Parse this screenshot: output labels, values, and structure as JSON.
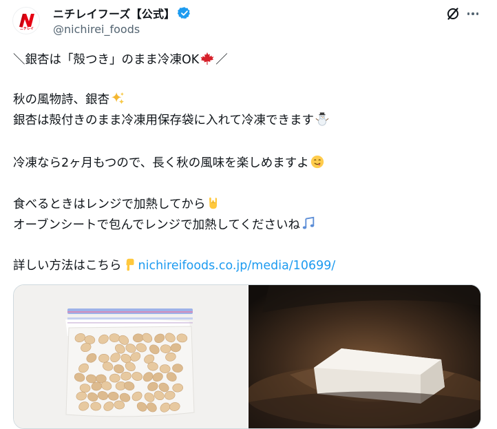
{
  "account": {
    "display_name": "ニチレイフーズ【公式】",
    "handle": "@nichirei_foods",
    "logo_text": "ニチレイ",
    "verified": true,
    "brand_color": "#e60012"
  },
  "post": {
    "lines": [
      {
        "parts": [
          {
            "text": "＼銀杏は「殻つき」のまま冷凍OK"
          },
          {
            "emoji": "maple-leaf"
          },
          {
            "text": "／"
          }
        ]
      },
      {
        "parts": [
          {
            "text": "秋の風物詩、銀杏"
          },
          {
            "emoji": "sparkles"
          }
        ]
      },
      {
        "parts": [
          {
            "text": "銀杏は殻付きのまま冷凍用保存袋に入れて冷凍できます"
          },
          {
            "emoji": "snowman"
          }
        ]
      },
      {
        "parts": [
          {
            "text": "冷凍なら2ヶ月もつので、長く秋の風味を楽しめますよ"
          },
          {
            "emoji": "yum-face"
          }
        ]
      },
      {
        "parts": [
          {
            "text": "食べるときはレンジで加熱してから"
          },
          {
            "emoji": "rock-on-hand"
          }
        ]
      },
      {
        "parts": [
          {
            "text": "オーブンシートで包んでレンジで加熱してくださいね"
          },
          {
            "emoji": "musical-notes"
          }
        ]
      },
      {
        "parts": [
          {
            "text": "詳しい方法はこちら"
          },
          {
            "emoji": "pointing-down"
          },
          {
            "link": "nichireifoods.co.jp/media/10699/"
          }
        ]
      }
    ],
    "link_color": "#1d9bf0"
  },
  "media": {
    "images": [
      {
        "name": "ginkgo-nuts-in-freezer-bag-photo"
      },
      {
        "name": "wrapped-packet-in-microwave-photo"
      }
    ]
  },
  "actions": {
    "grok_icon": "grok-icon",
    "more_icon": "more-options-icon"
  }
}
